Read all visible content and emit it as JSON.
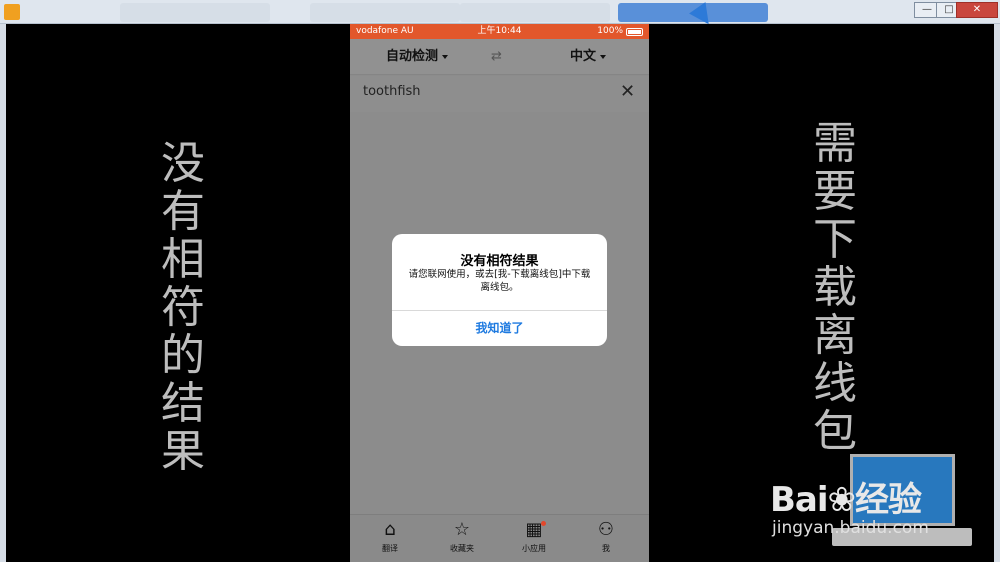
{
  "phone": {
    "status": {
      "carrier": "vodafone AU",
      "time": "上午10:44",
      "battery": "100%"
    },
    "lang": {
      "source": "自动检测",
      "target": "中文"
    },
    "query": "toothfish",
    "tabs": [
      {
        "label": "翻译",
        "icon": "home-icon"
      },
      {
        "label": "收藏夹",
        "icon": "star-icon"
      },
      {
        "label": "小应用",
        "icon": "grid-icon"
      },
      {
        "label": "我",
        "icon": "user-icon"
      }
    ],
    "alert": {
      "title": "没有相符结果",
      "message": "请您联网使用，或去[我-下载离线包]中下载离线包。",
      "button": "我知道了"
    }
  },
  "left_caption": [
    "没",
    "有",
    "相",
    "符",
    "的",
    "结",
    "果"
  ],
  "right_caption": [
    "需",
    "要",
    "下",
    "载",
    "离",
    "线",
    "包"
  ],
  "watermark": {
    "brand": "Bai",
    "brand_cn": "经验",
    "url": "jingyan.baidu.com"
  },
  "colors": {
    "status_bar": "#e2572b",
    "alert_button": "#1e7ae0",
    "badge": "#e2472b"
  }
}
